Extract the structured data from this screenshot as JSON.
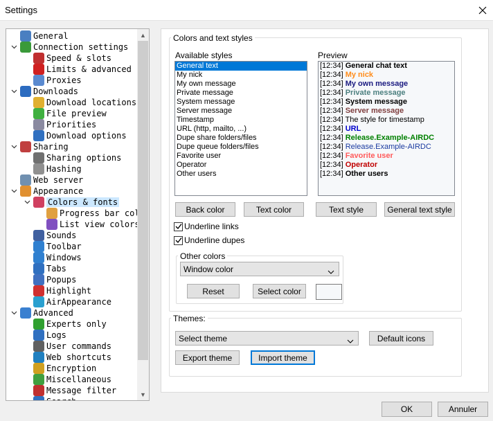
{
  "window": {
    "title": "Settings"
  },
  "tree": {
    "items": [
      {
        "label": "General",
        "icon": "user-icon",
        "color": "#4a7fc1"
      },
      {
        "label": "Connection settings",
        "icon": "connection-icon",
        "color": "#3a9a3a",
        "expanded": true
      },
      {
        "label": "Speed & slots",
        "icon": "speed-icon",
        "color": "#c03030"
      },
      {
        "label": "Limits & advanced",
        "icon": "limit-60-icon",
        "color": "#d02020"
      },
      {
        "label": "Proxies",
        "icon": "proxy-icon",
        "color": "#5a8ad0"
      },
      {
        "label": "Downloads",
        "icon": "downloads-icon",
        "color": "#2c6cc0",
        "expanded": true
      },
      {
        "label": "Download locations",
        "icon": "folder-icon",
        "color": "#e0b030"
      },
      {
        "label": "File preview",
        "icon": "play-icon",
        "color": "#40b040"
      },
      {
        "label": "Priorities",
        "icon": "priorities-icon",
        "color": "#8a8aa0"
      },
      {
        "label": "Download options",
        "icon": "download-options-icon",
        "color": "#3070c0"
      },
      {
        "label": "Sharing",
        "icon": "sharing-icon",
        "color": "#c04040",
        "expanded": true
      },
      {
        "label": "Sharing options",
        "icon": "sharing-options-icon",
        "color": "#707070"
      },
      {
        "label": "Hashing",
        "icon": "hashing-icon",
        "color": "#909090"
      },
      {
        "label": "Web server",
        "icon": "web-server-icon",
        "color": "#7090b0"
      },
      {
        "label": "Appearance",
        "icon": "appearance-icon",
        "color": "#e09030",
        "expanded": true
      },
      {
        "label": "Colors & fonts",
        "icon": "palette-icon",
        "color": "#d04060",
        "expanded": true,
        "selected": true
      },
      {
        "label": "Progress bar colors",
        "icon": "progress-bar-icon",
        "color": "#e0a040"
      },
      {
        "label": "List view colors",
        "icon": "list-view-icon",
        "color": "#8050c0"
      },
      {
        "label": "Sounds",
        "icon": "sounds-icon",
        "color": "#4060a0"
      },
      {
        "label": "Toolbar",
        "icon": "toolbar-icon",
        "color": "#3080d0"
      },
      {
        "label": "Windows",
        "icon": "windows-icon",
        "color": "#3080d0"
      },
      {
        "label": "Tabs",
        "icon": "tabs-icon",
        "color": "#3070c0"
      },
      {
        "label": "Popups",
        "icon": "popups-icon",
        "color": "#4070c0"
      },
      {
        "label": "Highlight",
        "icon": "highlight-icon",
        "color": "#d03030"
      },
      {
        "label": "AirAppearance",
        "icon": "air-appearance-icon",
        "color": "#2aa0d0"
      },
      {
        "label": "Advanced",
        "icon": "advanced-icon",
        "color": "#3a80d0",
        "expanded": true
      },
      {
        "label": "Experts only",
        "icon": "experts-icon",
        "color": "#30a030"
      },
      {
        "label": "Logs",
        "icon": "logs-icon",
        "color": "#3070c0"
      },
      {
        "label": "User commands",
        "icon": "user-commands-icon",
        "color": "#606060"
      },
      {
        "label": "Web shortcuts",
        "icon": "web-shortcuts-icon",
        "color": "#2080c0"
      },
      {
        "label": "Encryption",
        "icon": "lock-icon",
        "color": "#d0a020"
      },
      {
        "label": "Miscellaneous",
        "icon": "misc-icon",
        "color": "#40a040"
      },
      {
        "label": "Message filter",
        "icon": "message-filter-icon",
        "color": "#c03030"
      },
      {
        "label": "Search",
        "icon": "search-icon",
        "color": "#3070c0"
      }
    ]
  },
  "colors_group": {
    "title": "Colors and text styles",
    "available_label": "Available styles",
    "preview_label": "Preview",
    "styles": [
      "General text",
      "My nick",
      "My own message",
      "Private message",
      "System message",
      "Server message",
      "Timestamp",
      "URL (http, mailto, ...)",
      "Dupe share folders/files",
      "Dupe queue folders/files",
      "Favorite user",
      "Operator",
      "Other users"
    ],
    "preview": [
      {
        "ts": "[12:34]",
        "text": "General chat text",
        "color": "#000000",
        "bold": true
      },
      {
        "ts": "[12:34]",
        "text": "My nick",
        "color": "#ff8c1a",
        "bold": true
      },
      {
        "ts": "[12:34]",
        "text": "My own message",
        "color": "#1a1a80",
        "bold": true
      },
      {
        "ts": "[12:34]",
        "text": "Private message",
        "color": "#4d8080",
        "bold": true
      },
      {
        "ts": "[12:34]",
        "text": "System message",
        "color": "#000000",
        "bold": true
      },
      {
        "ts": "[12:34]",
        "text": "Server message",
        "color": "#804040",
        "bold": true
      },
      {
        "ts": "[12:34]",
        "text": "The style for timestamp",
        "color": "#000000",
        "bold": false
      },
      {
        "ts": "[12:34]",
        "text": "URL",
        "color": "#0000cc",
        "bold": true
      },
      {
        "ts": "[12:34]",
        "text": "Release.Example-AIRDC",
        "color": "#008000",
        "bold": true
      },
      {
        "ts": "[12:34]",
        "text": "Release.Example-AIRDC",
        "color": "#1a3aa0",
        "bold": false
      },
      {
        "ts": "[12:34]",
        "text": "Favorite user",
        "color": "#ff5a5a",
        "bold": true
      },
      {
        "ts": "[12:34]",
        "text": "Operator",
        "color": "#c00000",
        "bold": true
      },
      {
        "ts": "[12:34]",
        "text": "Other users",
        "color": "#000000",
        "bold": true
      }
    ],
    "buttons": {
      "back_color": "Back color",
      "text_color": "Text color",
      "text_style": "Text style",
      "general_text_style": "General text style"
    },
    "underline_links": "Underline links",
    "underline_dupes": "Underline dupes",
    "other_colors": {
      "title": "Other colors",
      "selected": "Window color",
      "reset": "Reset",
      "select_color": "Select color"
    }
  },
  "themes_group": {
    "title": "Themes:",
    "selected": "Select theme",
    "default_icons": "Default icons",
    "export": "Export theme",
    "import": "Import theme"
  },
  "footer": {
    "ok": "OK",
    "cancel": "Annuler"
  }
}
